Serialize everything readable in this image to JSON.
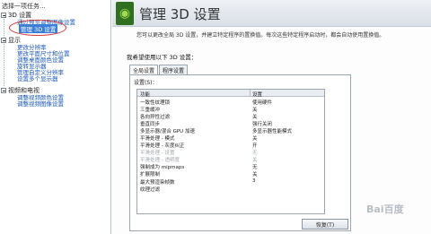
{
  "left_pane": {
    "task_header": "选择一项任务...",
    "categories": [
      {
        "label": "3D 设置",
        "items": [
          "通过预览调整图像设置",
          "管理 3D 设置"
        ]
      },
      {
        "label": "显示",
        "items": [
          "更改分辨率",
          "更改平面尺寸和位置",
          "调整桌面颜色设置",
          "旋转显示器",
          "管理自定义分辨率",
          "设置多个显示器"
        ]
      },
      {
        "label": "视频和电视",
        "items": [
          "调整视频颜色设置",
          "调整视频图像设置"
        ]
      }
    ]
  },
  "header": {
    "logo_glyph": "◉",
    "title": "管理 3D 设置"
  },
  "description": "您可以更改全局 3D 设置，并建立特定程序的置换值。每次这些特定程序启动时，都会自动使用置换值。",
  "section_title": "我希望使用以下 3D 设置：",
  "tabs": [
    "全局设置",
    "程序设置"
  ],
  "settings_label": "设置(S)：",
  "table": {
    "headers": {
      "feature": "功能",
      "setting": "设置"
    },
    "rows": [
      {
        "feature": "一致性纹理锁",
        "value": "使用硬件",
        "dim": false
      },
      {
        "feature": "三重缓冲",
        "value": "关",
        "dim": false
      },
      {
        "feature": "各向异性过滤",
        "value": "关",
        "dim": false
      },
      {
        "feature": "垂直同步",
        "value": "强行关闭",
        "dim": false
      },
      {
        "feature": "多显示器/混合 GPU 加速",
        "value": "多显示器性能模式",
        "dim": false
      },
      {
        "feature": "平滑处理 - 模式",
        "value": "关",
        "dim": false
      },
      {
        "feature": "平滑处理 - 灰度纠正",
        "value": "开",
        "dim": false
      },
      {
        "feature": "平滑处理 - 设置",
        "value": "无",
        "dim": true
      },
      {
        "feature": "平滑处理 - 透明度",
        "value": "关",
        "dim": true
      },
      {
        "feature": "强制成为 mipmaps",
        "value": "无",
        "dim": false
      },
      {
        "feature": "扩展限制",
        "value": "关",
        "dim": false
      },
      {
        "feature": "最大预渲染帧数",
        "value": "3",
        "dim": false
      },
      {
        "feature": "纹理过滤",
        "value": "",
        "dim": false
      }
    ]
  },
  "restore_button": "恢复(T)",
  "watermark": "Bai百度"
}
